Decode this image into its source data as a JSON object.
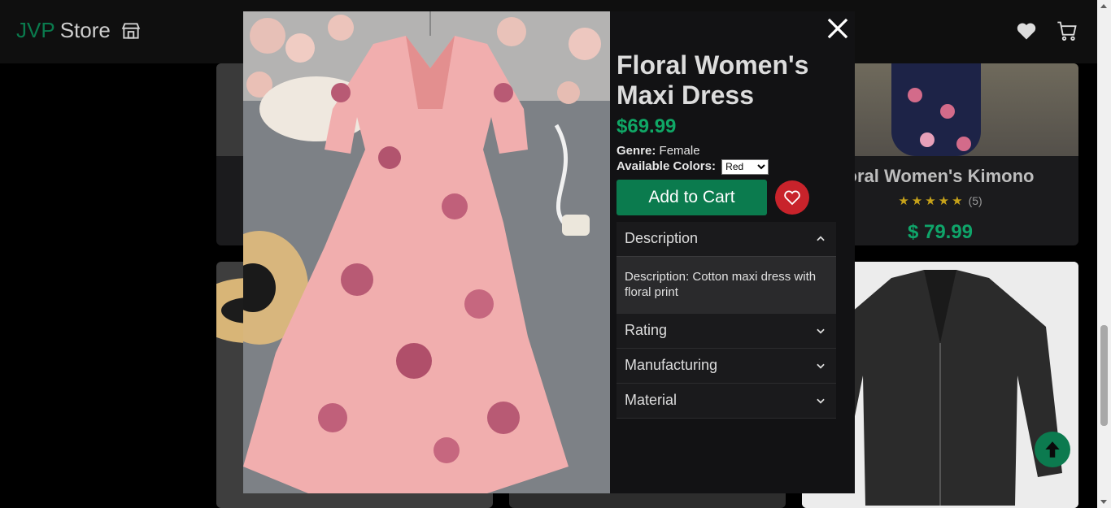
{
  "navbar": {
    "brand_primary": "JVP",
    "brand_secondary": "Store",
    "brand_icon": "storefront-icon",
    "icons": [
      "heart-icon",
      "cart-icon"
    ]
  },
  "background_cards": {
    "kimono": {
      "title": "oral Women's Kimono",
      "rating_count": "(5)",
      "rating_stars": 5,
      "price": "$ 79.99"
    }
  },
  "modal": {
    "close_icon": "close-icon",
    "title": "Floral Women's Maxi Dress",
    "price": "$69.99",
    "genre_label": "Genre:",
    "genre_value": "Female",
    "colors_label": "Available Colors:",
    "selected_color": "Red",
    "add_to_cart_label": "Add to Cart",
    "favorite_icon": "heart-outline-icon",
    "accordion": [
      {
        "label": "Description",
        "expanded": true,
        "content": "Description: Cotton maxi dress with floral print"
      },
      {
        "label": "Rating",
        "expanded": false
      },
      {
        "label": "Manufacturing",
        "expanded": false
      },
      {
        "label": "Material",
        "expanded": false
      }
    ]
  },
  "scroll_top_icon": "arrow-up-icon",
  "colors": {
    "accent_green": "#0b7b4e",
    "price_green": "#10a766",
    "favorite_red": "#c8232b"
  }
}
